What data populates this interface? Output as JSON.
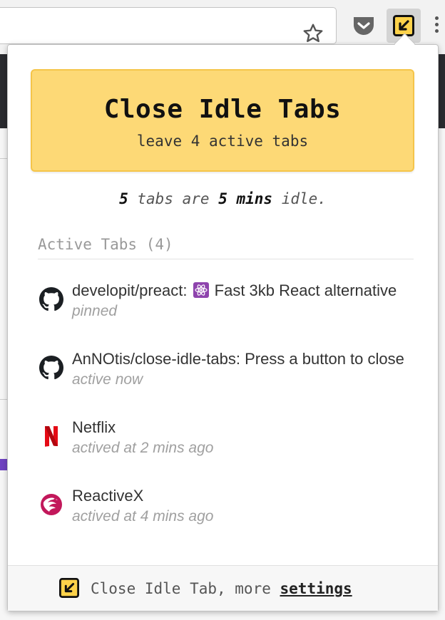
{
  "extension": {
    "button_title": "Close Idle Tabs",
    "button_subtitle": "leave 4 active tabs",
    "idle_summary": {
      "count": "5",
      "text_tabs_are": " tabs are ",
      "duration": "5 mins",
      "text_idle": " idle."
    },
    "active_tabs_heading": "Active Tabs (4)",
    "tabs": [
      {
        "icon": "github-icon",
        "title_before_emoji": "developit/preact: ",
        "title_after_emoji": " Fast 3kb React alternative",
        "status": "pinned"
      },
      {
        "icon": "github-icon",
        "title": "AnNOtis/close-idle-tabs: Press a button to close idle tabs",
        "status": "active now"
      },
      {
        "icon": "netflix-icon",
        "title": "Netflix",
        "status": "actived at 2 mins ago"
      },
      {
        "icon": "reactivex-icon",
        "title": "ReactiveX",
        "status": "actived at 4 mins ago"
      }
    ],
    "footer": {
      "text": "Close Idle Tab, more ",
      "settings_link": "settings"
    }
  },
  "colors": {
    "button_bg": "#fdd976",
    "button_border": "#f5c54a",
    "muted_text": "#a0a0a0",
    "netflix_red": "#e50914",
    "reactivex_pink": "#c2185b"
  }
}
